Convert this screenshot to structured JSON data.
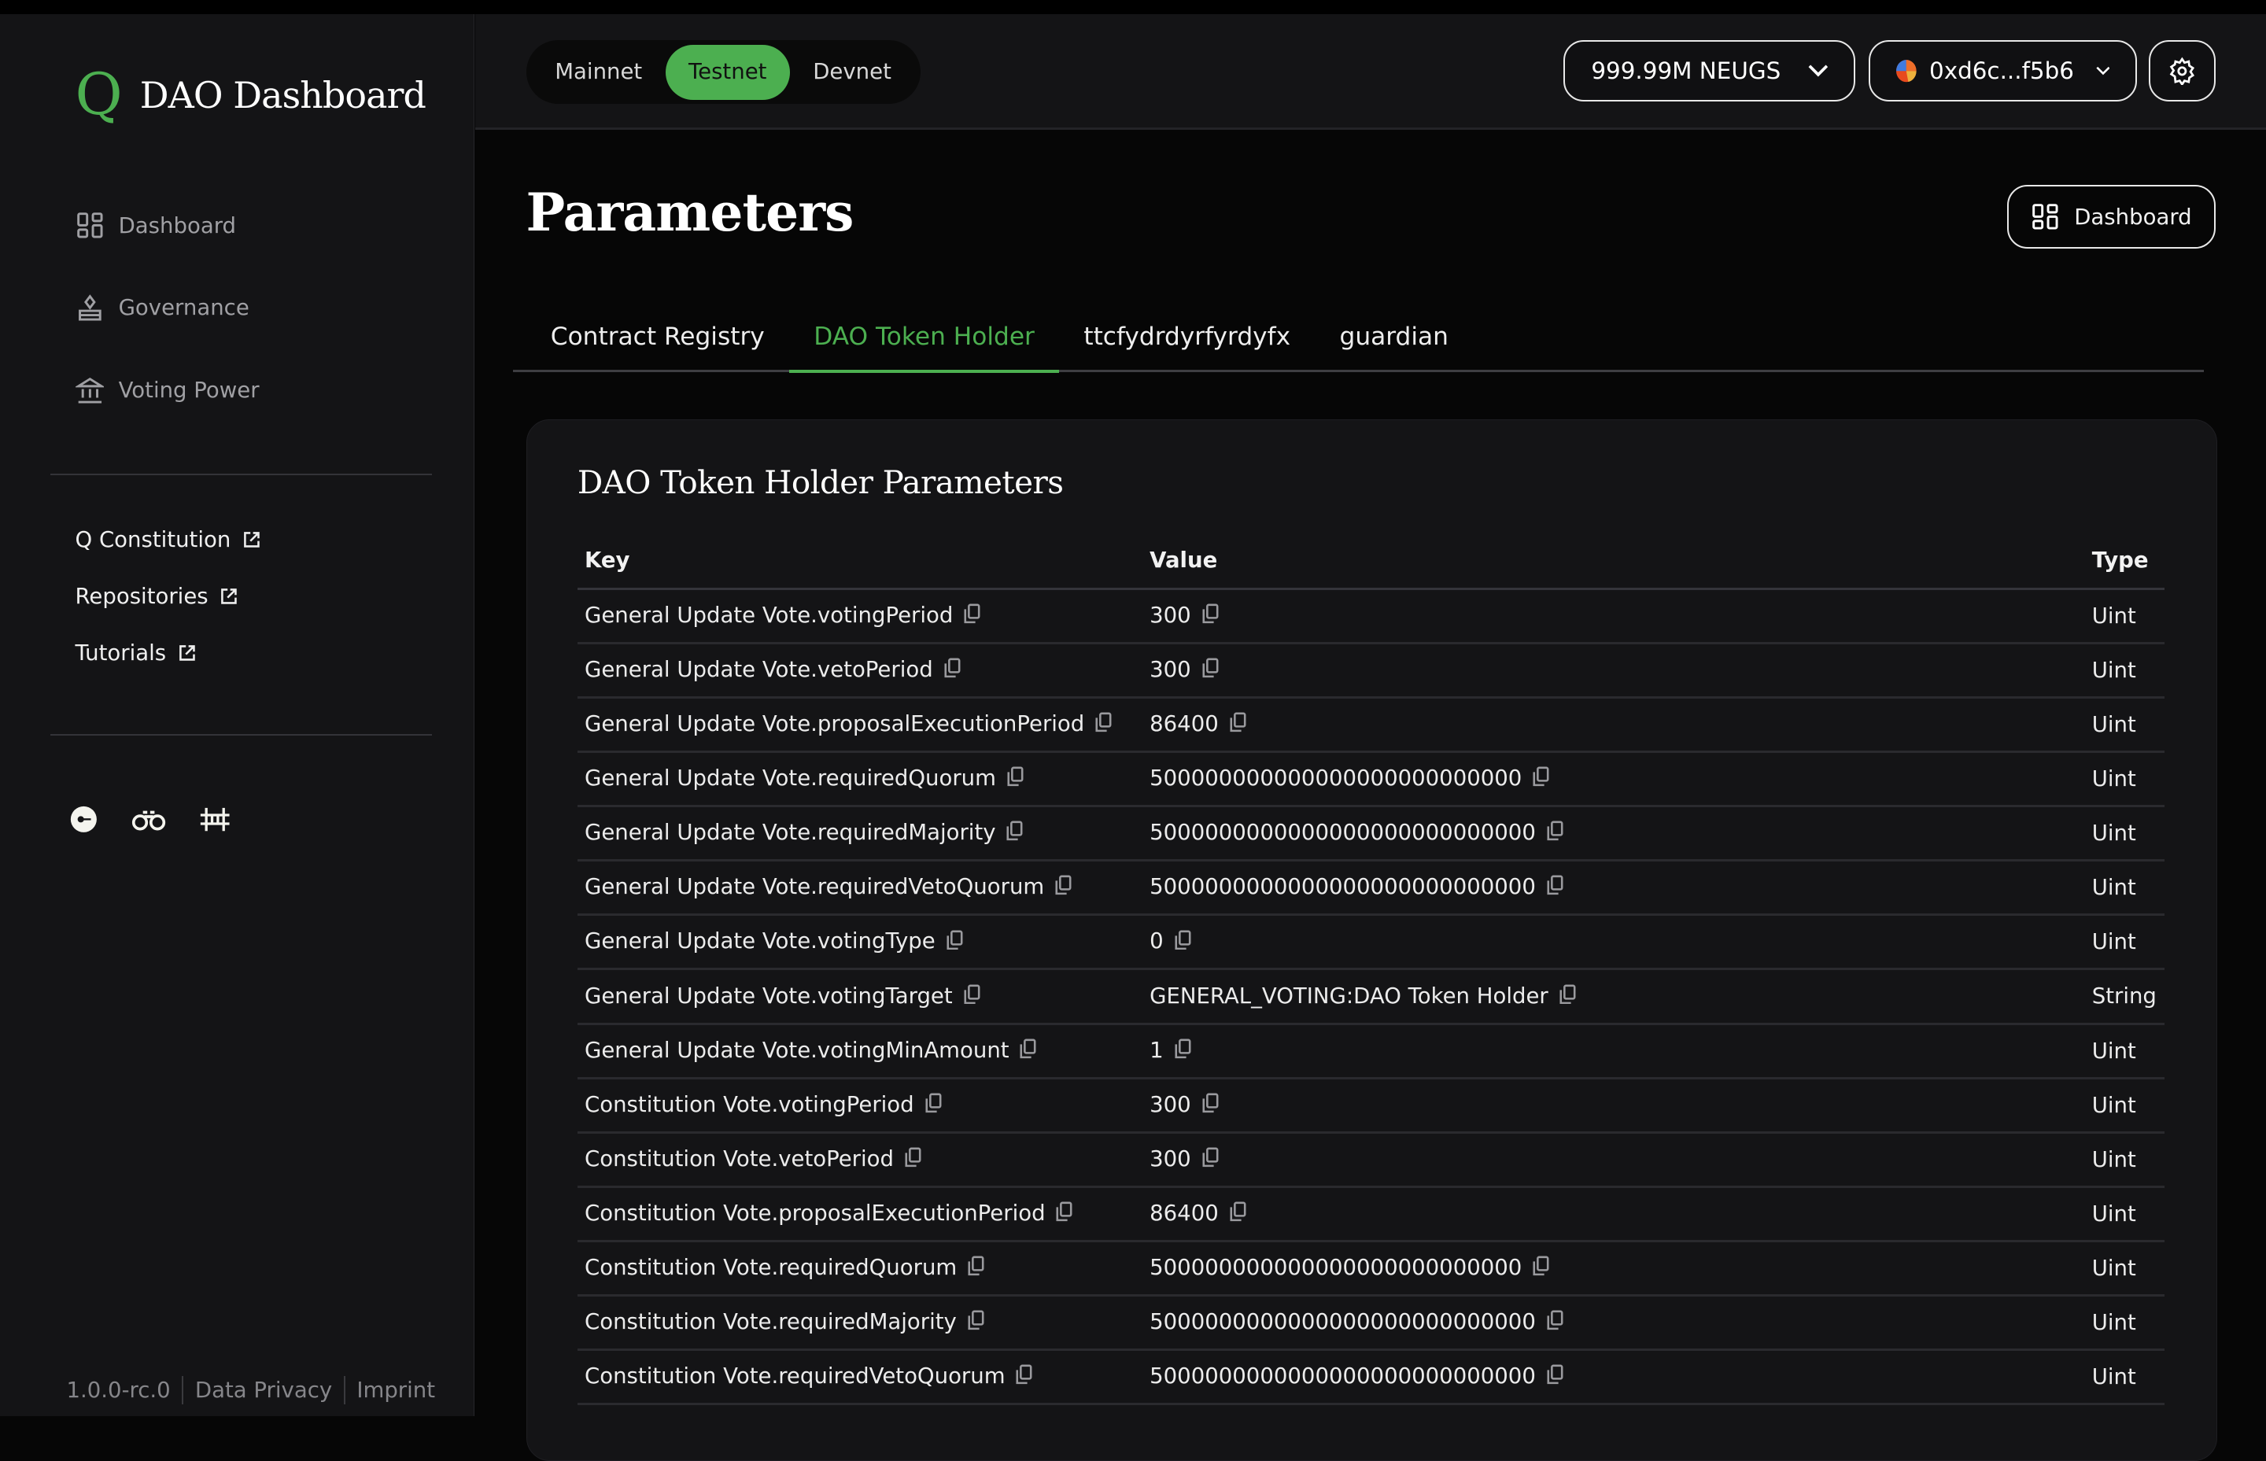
{
  "app": {
    "logo_letter": "Q",
    "title": "DAO Dashboard"
  },
  "sidebar": {
    "nav": [
      {
        "label": "Dashboard",
        "icon": "dashboard-icon"
      },
      {
        "label": "Governance",
        "icon": "governance-icon"
      },
      {
        "label": "Voting Power",
        "icon": "bank-icon"
      }
    ],
    "links": [
      {
        "label": "Q Constitution"
      },
      {
        "label": "Repositories"
      },
      {
        "label": "Tutorials"
      }
    ],
    "socials": [
      "discord-icon",
      "binoculars-icon",
      "bridge-icon"
    ],
    "footer": {
      "version": "1.0.0-rc.0",
      "privacy": "Data Privacy",
      "imprint": "Imprint"
    }
  },
  "header": {
    "networks": [
      {
        "label": "Mainnet"
      },
      {
        "label": "Testnet",
        "active": true
      },
      {
        "label": "Devnet"
      }
    ],
    "balance": "999.99M NEUGS",
    "account": "0xd6c...f5b6",
    "accent": "#4caf50"
  },
  "page": {
    "title": "Parameters",
    "dashboard_button": "Dashboard",
    "tabs": [
      "Contract Registry",
      "DAO Token Holder",
      "ttcfydrdyrfyrdyfx",
      "guardian"
    ],
    "active_tab": "DAO Token Holder"
  },
  "card": {
    "title": "DAO Token Holder Parameters",
    "columns": {
      "key": "Key",
      "value": "Value",
      "type": "Type"
    },
    "rows": [
      {
        "key": "General Update Vote.votingPeriod",
        "value": "300",
        "type": "Uint"
      },
      {
        "key": "General Update Vote.vetoPeriod",
        "value": "300",
        "type": "Uint"
      },
      {
        "key": "General Update Vote.proposalExecutionPeriod",
        "value": "86400",
        "type": "Uint"
      },
      {
        "key": "General Update Vote.requiredQuorum",
        "value": "500000000000000000000000000",
        "type": "Uint"
      },
      {
        "key": "General Update Vote.requiredMajority",
        "value": "5000000000000000000000000000",
        "type": "Uint"
      },
      {
        "key": "General Update Vote.requiredVetoQuorum",
        "value": "5000000000000000000000000000",
        "type": "Uint"
      },
      {
        "key": "General Update Vote.votingType",
        "value": "0",
        "type": "Uint"
      },
      {
        "key": "General Update Vote.votingTarget",
        "value": "GENERAL_VOTING:DAO Token Holder",
        "type": "String"
      },
      {
        "key": "General Update Vote.votingMinAmount",
        "value": "1",
        "type": "Uint"
      },
      {
        "key": "Constitution Vote.votingPeriod",
        "value": "300",
        "type": "Uint"
      },
      {
        "key": "Constitution Vote.vetoPeriod",
        "value": "300",
        "type": "Uint"
      },
      {
        "key": "Constitution Vote.proposalExecutionPeriod",
        "value": "86400",
        "type": "Uint"
      },
      {
        "key": "Constitution Vote.requiredQuorum",
        "value": "500000000000000000000000000",
        "type": "Uint"
      },
      {
        "key": "Constitution Vote.requiredMajority",
        "value": "5000000000000000000000000000",
        "type": "Uint"
      },
      {
        "key": "Constitution Vote.requiredVetoQuorum",
        "value": "5000000000000000000000000000",
        "type": "Uint"
      }
    ]
  }
}
